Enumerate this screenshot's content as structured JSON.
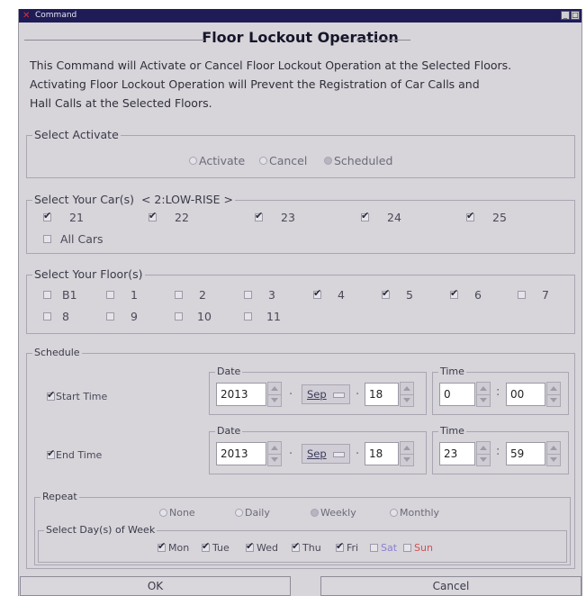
{
  "window": {
    "title": "Command",
    "btn_min": "_",
    "btn_max": "□"
  },
  "heading": "Floor Lockout Operation",
  "description": [
    "This Command will Activate or Cancel Floor Lockout Operation at the Selected Floors.",
    "Activating Floor Lockout Operation will Prevent the Registration of Car Calls and",
    "Hall Calls at the Selected Floors."
  ],
  "activate": {
    "legend": "Select Activate",
    "options": [
      {
        "label": "Activate",
        "selected": false
      },
      {
        "label": "Cancel",
        "selected": false
      },
      {
        "label": "Scheduled",
        "selected": true
      }
    ]
  },
  "cars": {
    "legend": "Select Your Car(s)",
    "group": "< 2:LOW-RISE >",
    "items": [
      {
        "label": "21",
        "checked": true
      },
      {
        "label": "22",
        "checked": true
      },
      {
        "label": "23",
        "checked": true
      },
      {
        "label": "24",
        "checked": true
      },
      {
        "label": "25",
        "checked": true
      }
    ],
    "all_cars": {
      "label": "All Cars",
      "checked": false
    }
  },
  "floors": {
    "legend": "Select Your Floor(s)",
    "items": [
      {
        "label": "B1",
        "checked": false
      },
      {
        "label": "1",
        "checked": false
      },
      {
        "label": "2",
        "checked": false
      },
      {
        "label": "3",
        "checked": false
      },
      {
        "label": "4",
        "checked": true
      },
      {
        "label": "5",
        "checked": true
      },
      {
        "label": "6",
        "checked": true
      },
      {
        "label": "7",
        "checked": false
      },
      {
        "label": "8",
        "checked": false
      },
      {
        "label": "9",
        "checked": false
      },
      {
        "label": "10",
        "checked": false
      },
      {
        "label": "11",
        "checked": false
      }
    ]
  },
  "schedule": {
    "legend": "Schedule",
    "date_label": "Date",
    "time_label": "Time",
    "dot": ".",
    "colon": ":",
    "start": {
      "label": "Start Time",
      "checked": true,
      "year": "2013",
      "month": "Sep",
      "day": "18",
      "hour": "0",
      "minute": "00"
    },
    "end": {
      "label": "End Time",
      "checked": true,
      "year": "2013",
      "month": "Sep",
      "day": "18",
      "hour": "23",
      "minute": "59"
    }
  },
  "repeat": {
    "legend": "Repeat",
    "options": [
      {
        "label": "None",
        "selected": false
      },
      {
        "label": "Daily",
        "selected": false
      },
      {
        "label": "Weekly",
        "selected": true
      },
      {
        "label": "Monthly",
        "selected": false
      }
    ]
  },
  "days": {
    "legend": "Select Day(s) of Week",
    "items": [
      {
        "label": "Mon",
        "checked": true
      },
      {
        "label": "Tue",
        "checked": true
      },
      {
        "label": "Wed",
        "checked": true
      },
      {
        "label": "Thu",
        "checked": true
      },
      {
        "label": "Fri",
        "checked": true
      },
      {
        "label": "Sat",
        "checked": false
      },
      {
        "label": "Sun",
        "checked": false
      }
    ]
  },
  "buttons": {
    "ok": "OK",
    "cancel": "Cancel"
  },
  "colors": {
    "titlebar": "#1f1b57",
    "background": "#d7d4da",
    "sat": "#8b7fd0",
    "sun": "#d25050"
  }
}
